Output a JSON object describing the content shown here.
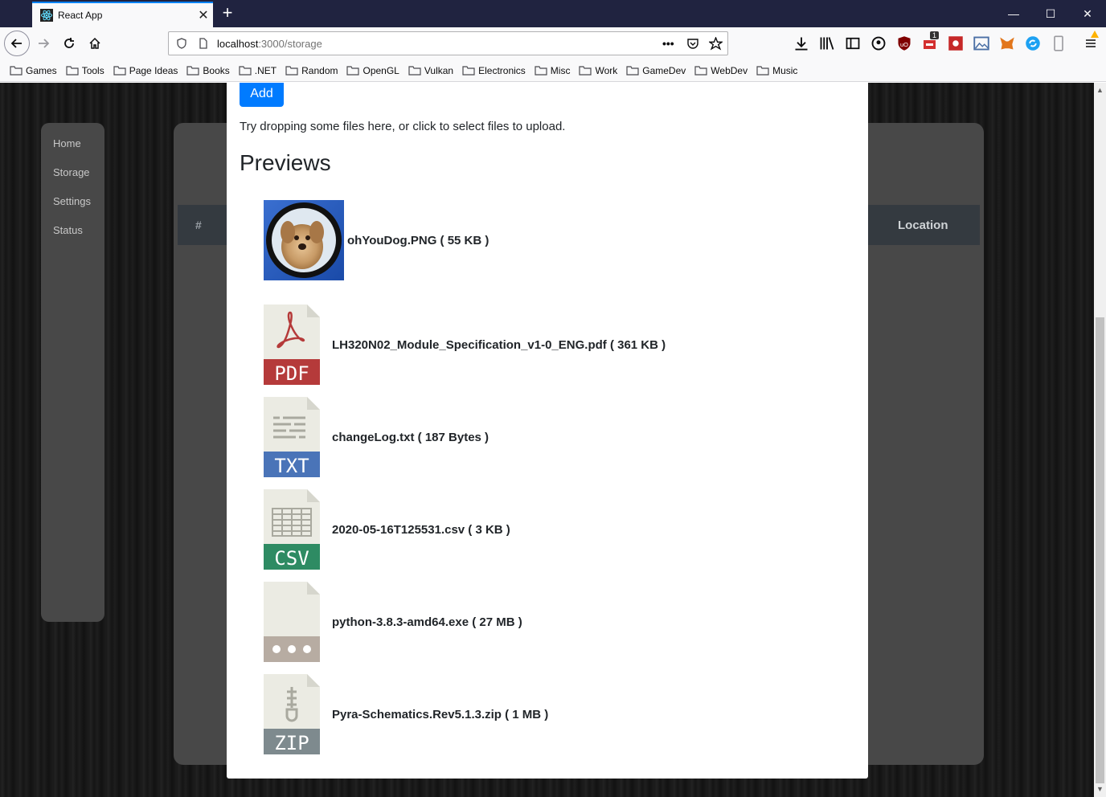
{
  "browser": {
    "tab_title": "React App",
    "url_host": "localhost",
    "url_path": ":3000/storage",
    "tab_close": "✕",
    "new_tab": "+",
    "window_controls": [
      "—",
      "☐",
      "✕"
    ],
    "bookmarks": [
      "Games",
      "Tools",
      "Page Ideas",
      "Books",
      ".NET",
      "Random",
      "OpenGL",
      "Vulkan",
      "Electronics",
      "Misc",
      "Work",
      "GameDev",
      "WebDev",
      "Music"
    ],
    "notification_badge": "1"
  },
  "sidebar": {
    "items": [
      {
        "label": "Home"
      },
      {
        "label": "Storage"
      },
      {
        "label": "Settings"
      },
      {
        "label": "Status"
      }
    ]
  },
  "table": {
    "col_num": "#",
    "col_location": "Location"
  },
  "modal": {
    "add_label": "Add",
    "drop_text": "Try dropping some files here, or click to select files to upload.",
    "previews_title": "Previews",
    "files": [
      {
        "name": "ohYouDog.PNG ( 55 KB )",
        "type": "image"
      },
      {
        "name": "LH320N02_Module_Specification_v1-0_ENG.pdf ( 361 KB )",
        "type": "pdf",
        "badge": "PDF"
      },
      {
        "name": "changeLog.txt ( 187 Bytes )",
        "type": "txt",
        "badge": "TXT"
      },
      {
        "name": "2020-05-16T125531.csv ( 3 KB )",
        "type": "csv",
        "badge": "CSV"
      },
      {
        "name": "python-3.8.3-amd64.exe ( 27 MB )",
        "type": "exe",
        "badge": "•••"
      },
      {
        "name": "Pyra-Schematics.Rev5.1.3.zip ( 1 MB )",
        "type": "zip",
        "badge": "ZIP"
      }
    ]
  },
  "colors": {
    "accent": "#007bff",
    "pdf": "#b53a3a",
    "txt": "#4a74b8",
    "csv": "#2e8b63",
    "exe": "#b7aca2",
    "zip": "#7e8a8e"
  }
}
